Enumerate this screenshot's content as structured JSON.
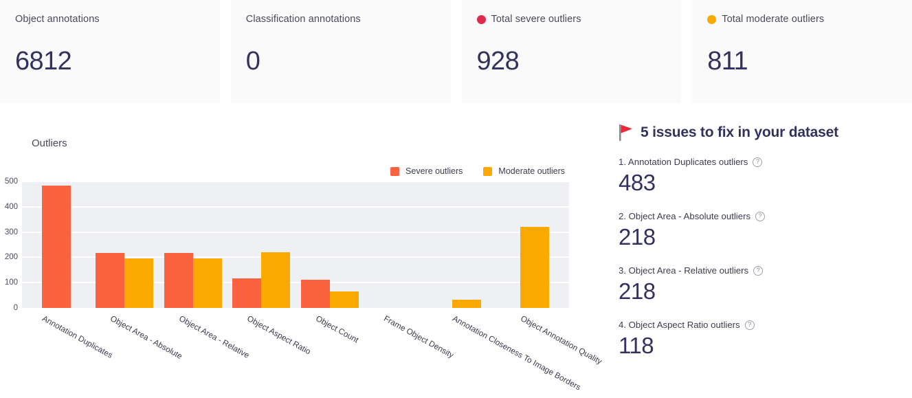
{
  "stats": [
    {
      "label": "Object annotations",
      "value": "6812",
      "dot": null,
      "dot_color": null
    },
    {
      "label": "Classification annotations",
      "value": "0",
      "dot": null,
      "dot_color": null
    },
    {
      "label": "Total severe outliers",
      "value": "928",
      "dot": "severe-dot",
      "dot_color": "#e02b4e"
    },
    {
      "label": "Total moderate outliers",
      "value": "811",
      "dot": "moderate-dot",
      "dot_color": "#fca904"
    }
  ],
  "chart": {
    "title": "Outliers",
    "legend": [
      {
        "label": "Severe outliers",
        "color": "#fb6340"
      },
      {
        "label": "Moderate outliers",
        "color": "#fca904"
      }
    ]
  },
  "chart_data": {
    "type": "bar",
    "title": "Outliers",
    "xlabel": "",
    "ylabel": "",
    "ylim": [
      0,
      500
    ],
    "yticks": [
      0,
      100,
      200,
      300,
      400,
      500
    ],
    "grid": true,
    "legend_position": "top-right",
    "categories": [
      "Annotation Duplicates",
      "Object Area - Absolute",
      "Object Area - Relative",
      "Object Aspect Ratio",
      "Object Count",
      "Frame Object Density",
      "Annotation Closeness To Image Borders",
      "Object Annotation Quality"
    ],
    "series": [
      {
        "name": "Severe outliers",
        "color": "#fb6340",
        "values": [
          483,
          218,
          218,
          118,
          111,
          0,
          0,
          0
        ]
      },
      {
        "name": "Moderate outliers",
        "color": "#fca904",
        "values": [
          0,
          196,
          196,
          219,
          66,
          0,
          32,
          322
        ]
      }
    ]
  },
  "issues": {
    "heading": "5 issues to fix in your dataset",
    "flag_icon": "flag-icon",
    "items": [
      {
        "label": "1. Annotation Duplicates outliers",
        "value": "483",
        "help": "?"
      },
      {
        "label": "2. Object Area - Absolute outliers",
        "value": "218",
        "help": "?"
      },
      {
        "label": "3. Object Area - Relative outliers",
        "value": "218",
        "help": "?"
      },
      {
        "label": "4. Object Aspect Ratio outliers",
        "value": "118",
        "help": "?"
      }
    ]
  }
}
